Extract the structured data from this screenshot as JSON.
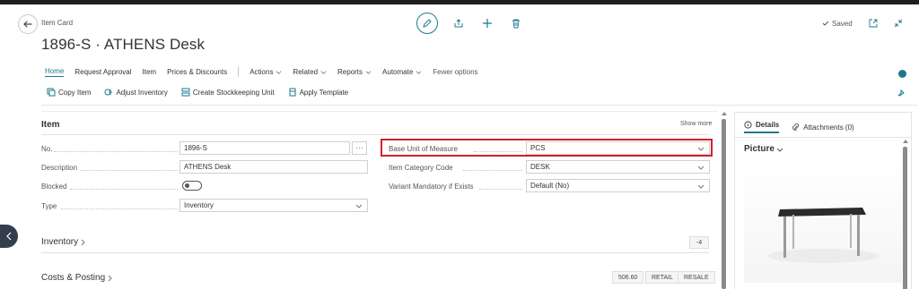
{
  "header": {
    "breadcrumb": "Item Card",
    "title": "1896-S · ATHENS Desk",
    "saved_label": "Saved"
  },
  "menu": {
    "items": [
      "Home",
      "Request Approval",
      "Item",
      "Prices & Discounts"
    ],
    "dropdowns": [
      "Actions",
      "Related",
      "Reports",
      "Automate"
    ],
    "fewer_options": "Fewer options"
  },
  "subbar": {
    "copy_item": "Copy Item",
    "adjust_inventory": "Adjust Inventory",
    "create_sku": "Create Stockkeeping Unit",
    "apply_template": "Apply Template"
  },
  "item_section": {
    "title": "Item",
    "show_more": "Show more",
    "fields": {
      "no_label": "No.",
      "no_value": "1896-S",
      "description_label": "Description",
      "description_value": "ATHENS Desk",
      "blocked_label": "Blocked",
      "blocked_value": false,
      "type_label": "Type",
      "type_value": "Inventory",
      "base_uom_label": "Base Unit of Measure",
      "base_uom_value": "PCS",
      "item_category_label": "Item Category Code",
      "item_category_value": "DESK",
      "variant_mandatory_label": "Variant Mandatory if Exists",
      "variant_mandatory_value": "Default (No)"
    }
  },
  "inventory_section": {
    "title": "Inventory",
    "value": "-4"
  },
  "costs_section": {
    "title": "Costs & Posting",
    "badges": [
      "506.60",
      "RETAIL",
      "RESALE"
    ]
  },
  "factbox": {
    "tab_details": "Details",
    "tab_attachments": "Attachments (0)",
    "picture_label": "Picture"
  },
  "colors": {
    "accent": "#1b7a8a",
    "highlight": "#d4202c"
  }
}
